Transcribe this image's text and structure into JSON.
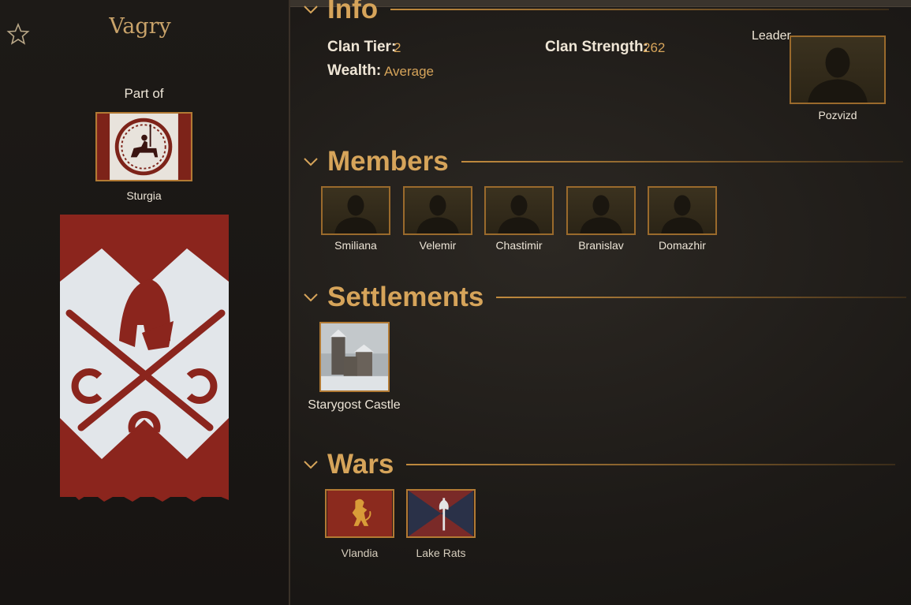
{
  "clan": {
    "name": "Vagry",
    "part_of_label": "Part of",
    "kingdom": "Sturgia"
  },
  "info": {
    "title": "Info",
    "clan_tier_label": "Clan Tier:",
    "clan_tier_value": "2",
    "clan_strength_label": "Clan Strength:",
    "clan_strength_value": "262",
    "wealth_label": "Wealth:",
    "wealth_value": "Average",
    "leader_label": "Leader",
    "leader_name": "Pozvizd"
  },
  "members": {
    "title": "Members",
    "items": [
      {
        "name": "Smiliana"
      },
      {
        "name": "Velemir"
      },
      {
        "name": "Chastimir"
      },
      {
        "name": "Branislav"
      },
      {
        "name": "Domazhir"
      }
    ]
  },
  "settlements": {
    "title": "Settlements",
    "items": [
      {
        "name": "Starygost Castle"
      }
    ]
  },
  "wars": {
    "title": "Wars",
    "items": [
      {
        "name": "Vlandia"
      },
      {
        "name": "Lake Rats"
      }
    ]
  },
  "colors": {
    "accent_gold": "#d6a45a",
    "border_gold": "#b27a34",
    "banner_red": "#8a2a20",
    "banner_white": "#e2e6ea"
  },
  "icons": [
    "star-icon",
    "chevron-down-icon",
    "silhouette-icon",
    "horseman-icon",
    "helmet-icon",
    "sword-icon",
    "horseshoe-icon",
    "lion-icon",
    "axe-icon",
    "castle-icon"
  ]
}
